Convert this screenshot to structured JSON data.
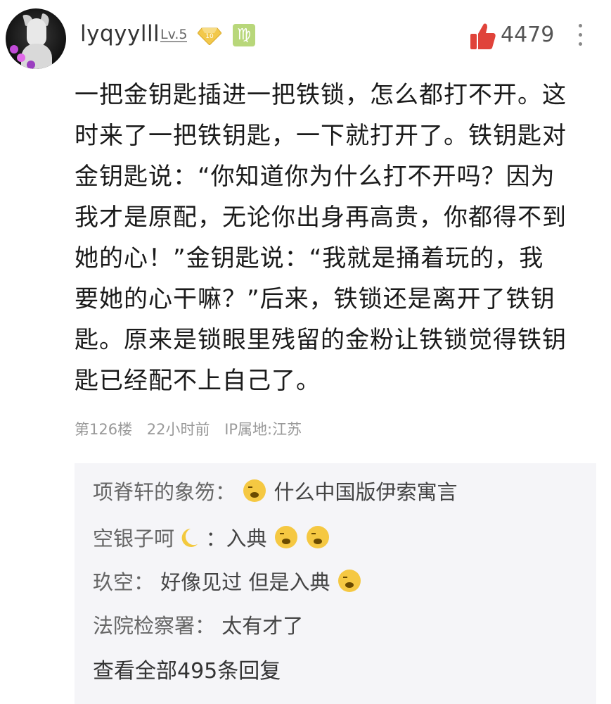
{
  "header": {
    "username": "lyqyylll",
    "level": "Lv.5",
    "diamond_badge": "10",
    "zodiac_symbol": "♍",
    "like_count": "4479",
    "icons": [
      "avatar",
      "diamond-icon",
      "virgo-icon",
      "thumbs-up-icon",
      "more-icon"
    ],
    "accent_color": "#e0433a"
  },
  "post": {
    "lines": [
      "一把金钥匙插进一把铁锁，怎么都打不开。这",
      "时来了一把铁钥匙，一下就打开了。铁钥匙对",
      "金钥匙说：“你知道你为什么打不开吗？因为",
      "我才是原配，无论你出身再高贵，你都得不到",
      "她的心！”金钥匙说：“我就是捅着玩的，我",
      "要她的心干嘛？”后来，铁锁还是离开了铁钥",
      "匙。原来是锁眼里残留的金粉让铁锁觉得铁钥",
      "匙已经配不上自己了。"
    ],
    "floor": "第126楼",
    "time": "22小时前",
    "ip": "IP属地:江苏"
  },
  "replies": {
    "items": [
      {
        "author": "项脊轩的象笏：",
        "text": "什么中国版伊索寓言"
      },
      {
        "author": "空银子呵",
        "text": "：入典"
      },
      {
        "author": "玖空：",
        "text": "好像见过 但是入典"
      },
      {
        "author": "法院检察署：",
        "text": "太有才了"
      }
    ],
    "view_all": "查看全部495条回复"
  }
}
